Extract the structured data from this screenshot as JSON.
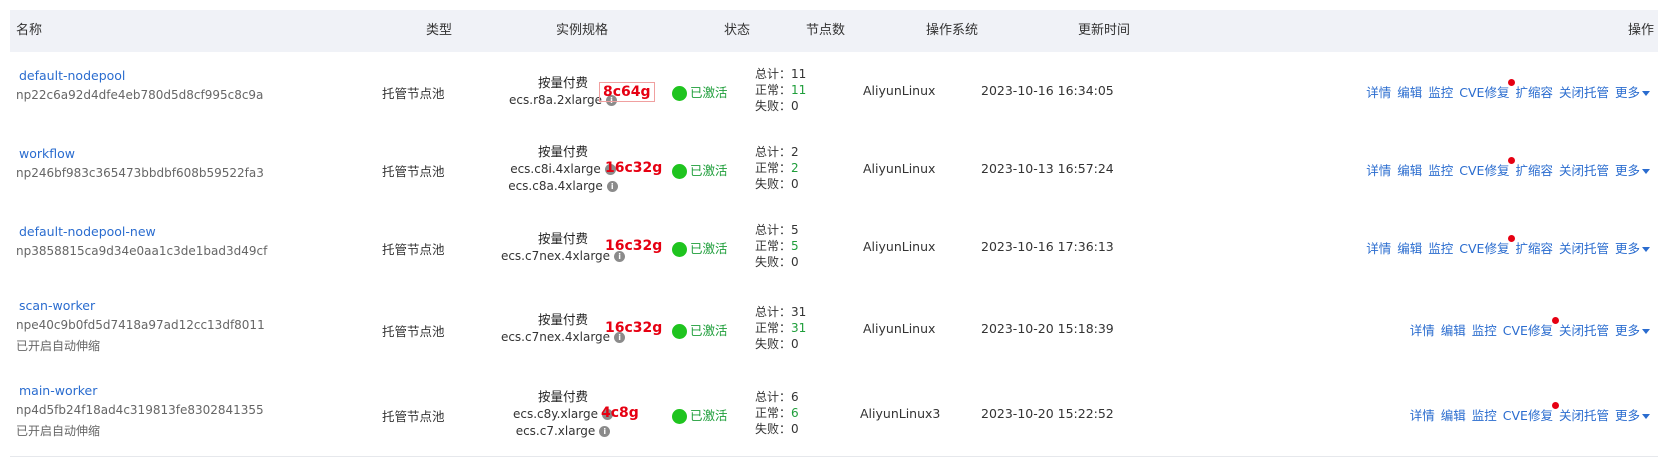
{
  "headers": {
    "name": "名称",
    "type": "类型",
    "spec": "实例规格",
    "status": "状态",
    "nodes": "节点数",
    "os": "操作系统",
    "updated": "更新时间",
    "actions": "操作"
  },
  "rows": [
    {
      "name": "default-nodepool",
      "id": "np22c6a92d4dfe4eb780d5d8cf995c8c9a",
      "autoscale": "",
      "type": "托管节点池",
      "billing": "按量付费",
      "specs": [
        "ecs.r8a.2xlarge"
      ],
      "tag": "8c64g",
      "status": "已激活",
      "nodes_total": "总计：11",
      "nodes_normal_label": "正常：",
      "nodes_normal_value": "11",
      "nodes_failed": "失败：0",
      "os": "AliyunLinux",
      "updated": "2023-10-16 16:34:05",
      "actions": [
        "详情",
        "编辑",
        "监控",
        "CVE修复",
        "扩缩容",
        "关闭托管",
        "更多"
      ]
    },
    {
      "name": "workflow",
      "id": "np246bf983c365473bbdbf608b59522fa3",
      "autoscale": "",
      "type": "托管节点池",
      "billing": "按量付费",
      "specs": [
        "ecs.c8i.4xlarge",
        "ecs.c8a.4xlarge"
      ],
      "tag": "16c32g",
      "status": "已激活",
      "nodes_total": "总计：2",
      "nodes_normal_label": "正常：",
      "nodes_normal_value": "2",
      "nodes_failed": "失败：0",
      "os": "AliyunLinux",
      "updated": "2023-10-13 16:57:24",
      "actions": [
        "详情",
        "编辑",
        "监控",
        "CVE修复",
        "扩缩容",
        "关闭托管",
        "更多"
      ]
    },
    {
      "name": "default-nodepool-new",
      "id": "np3858815ca9d34e0aa1c3de1bad3d49cf",
      "autoscale": "",
      "type": "托管节点池",
      "billing": "按量付费",
      "specs": [
        "ecs.c7nex.4xlarge"
      ],
      "tag": "16c32g",
      "status": "已激活",
      "nodes_total": "总计：5",
      "nodes_normal_label": "正常：",
      "nodes_normal_value": "5",
      "nodes_failed": "失败：0",
      "os": "AliyunLinux",
      "updated": "2023-10-16 17:36:13",
      "actions": [
        "详情",
        "编辑",
        "监控",
        "CVE修复",
        "扩缩容",
        "关闭托管",
        "更多"
      ]
    },
    {
      "name": "scan-worker",
      "id": "npe40c9b0fd5d7418a97ad12cc13df8011",
      "autoscale": "已开启自动伸缩",
      "type": "托管节点池",
      "billing": "按量付费",
      "specs": [
        "ecs.c7nex.4xlarge"
      ],
      "tag": "16c32g",
      "status": "已激活",
      "nodes_total": "总计：31",
      "nodes_normal_label": "正常：",
      "nodes_normal_value": "31",
      "nodes_failed": "失败：0",
      "os": "AliyunLinux",
      "updated": "2023-10-20 15:18:39",
      "actions": [
        "详情",
        "编辑",
        "监控",
        "CVE修复",
        "关闭托管",
        "更多"
      ]
    },
    {
      "name": "main-worker",
      "id": "np4d5fb24f18ad4c319813fe8302841355",
      "autoscale": "已开启自动伸缩",
      "type": "托管节点池",
      "billing": "按量付费",
      "specs": [
        "ecs.c8y.xlarge",
        "ecs.c7.xlarge"
      ],
      "tag": "4c8g",
      "status": "已激活",
      "nodes_total": "总计：6",
      "nodes_normal_label": "正常：",
      "nodes_normal_value": "6",
      "nodes_failed": "失败：0",
      "os": "AliyunLinux3",
      "updated": "2023-10-20 15:22:52",
      "actions": [
        "详情",
        "编辑",
        "监控",
        "CVE修复",
        "关闭托管",
        "更多"
      ]
    }
  ],
  "colors": {
    "link": "#2a6ccf",
    "status_green": "#1e9e3a",
    "status_dot": "#1fc41f",
    "tag_red": "#e60012",
    "header_bg": "#f0f2f7"
  }
}
